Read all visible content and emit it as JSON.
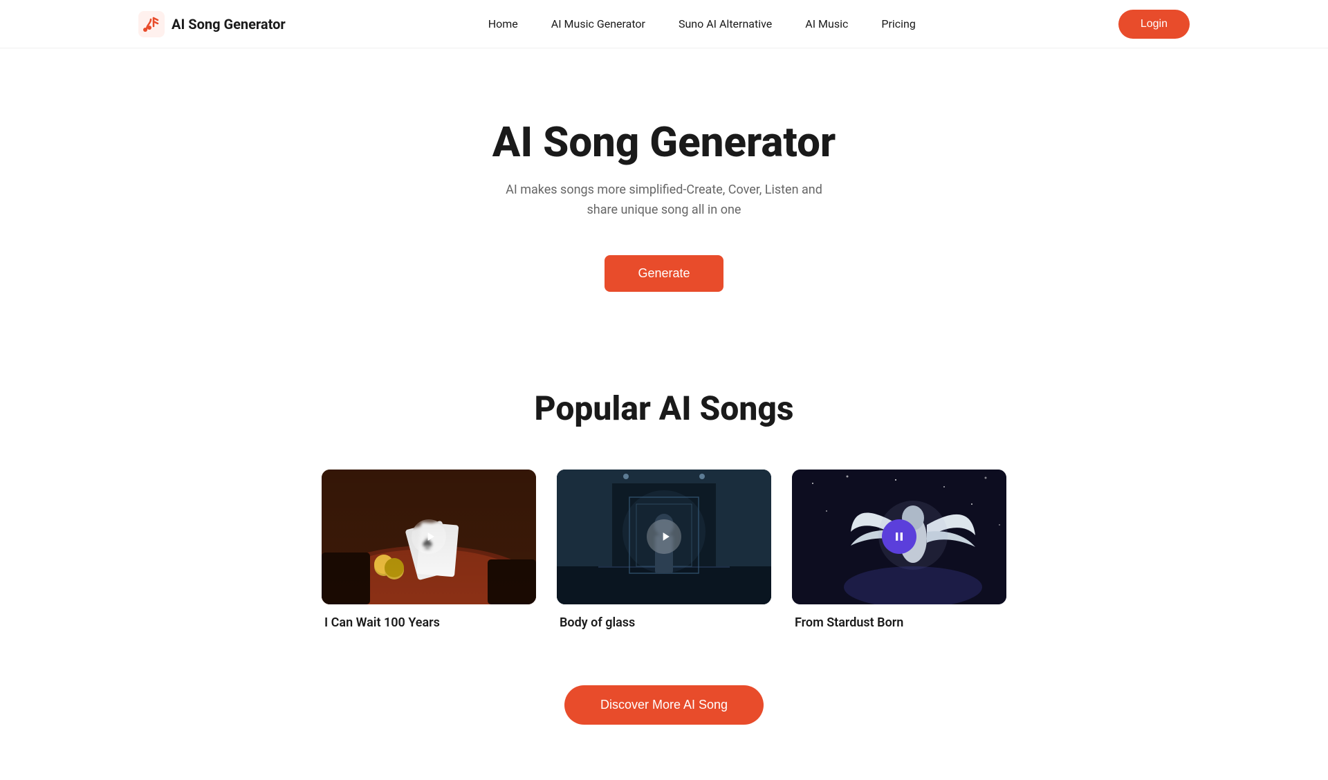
{
  "navbar": {
    "logo_text": "AI Song Generator",
    "nav_items": [
      {
        "label": "Home",
        "href": "#"
      },
      {
        "label": "AI Music Generator",
        "href": "#"
      },
      {
        "label": "Suno AI Alternative",
        "href": "#"
      },
      {
        "label": "AI Music",
        "href": "#"
      },
      {
        "label": "Pricing",
        "href": "#"
      }
    ],
    "login_label": "Login"
  },
  "hero": {
    "title": "AI Song Generator",
    "subtitle": "AI makes songs more simplified-Create, Cover, Listen and share unique song all in one",
    "generate_label": "Generate"
  },
  "popular": {
    "section_title": "Popular AI Songs",
    "songs": [
      {
        "id": 1,
        "title": "I Can Wait 100 Years",
        "playing": false,
        "thumb_type": "poker"
      },
      {
        "id": 2,
        "title": "Body of glass",
        "playing": false,
        "thumb_type": "urban"
      },
      {
        "id": 3,
        "title": "From Stardust Born",
        "playing": true,
        "thumb_type": "fantasy"
      }
    ]
  },
  "discover": {
    "label": "Discover More AI Song"
  },
  "colors": {
    "accent": "#e84c2b",
    "text_dark": "#1a1a1a",
    "text_muted": "#666666",
    "purple": "#5b3fdb"
  }
}
